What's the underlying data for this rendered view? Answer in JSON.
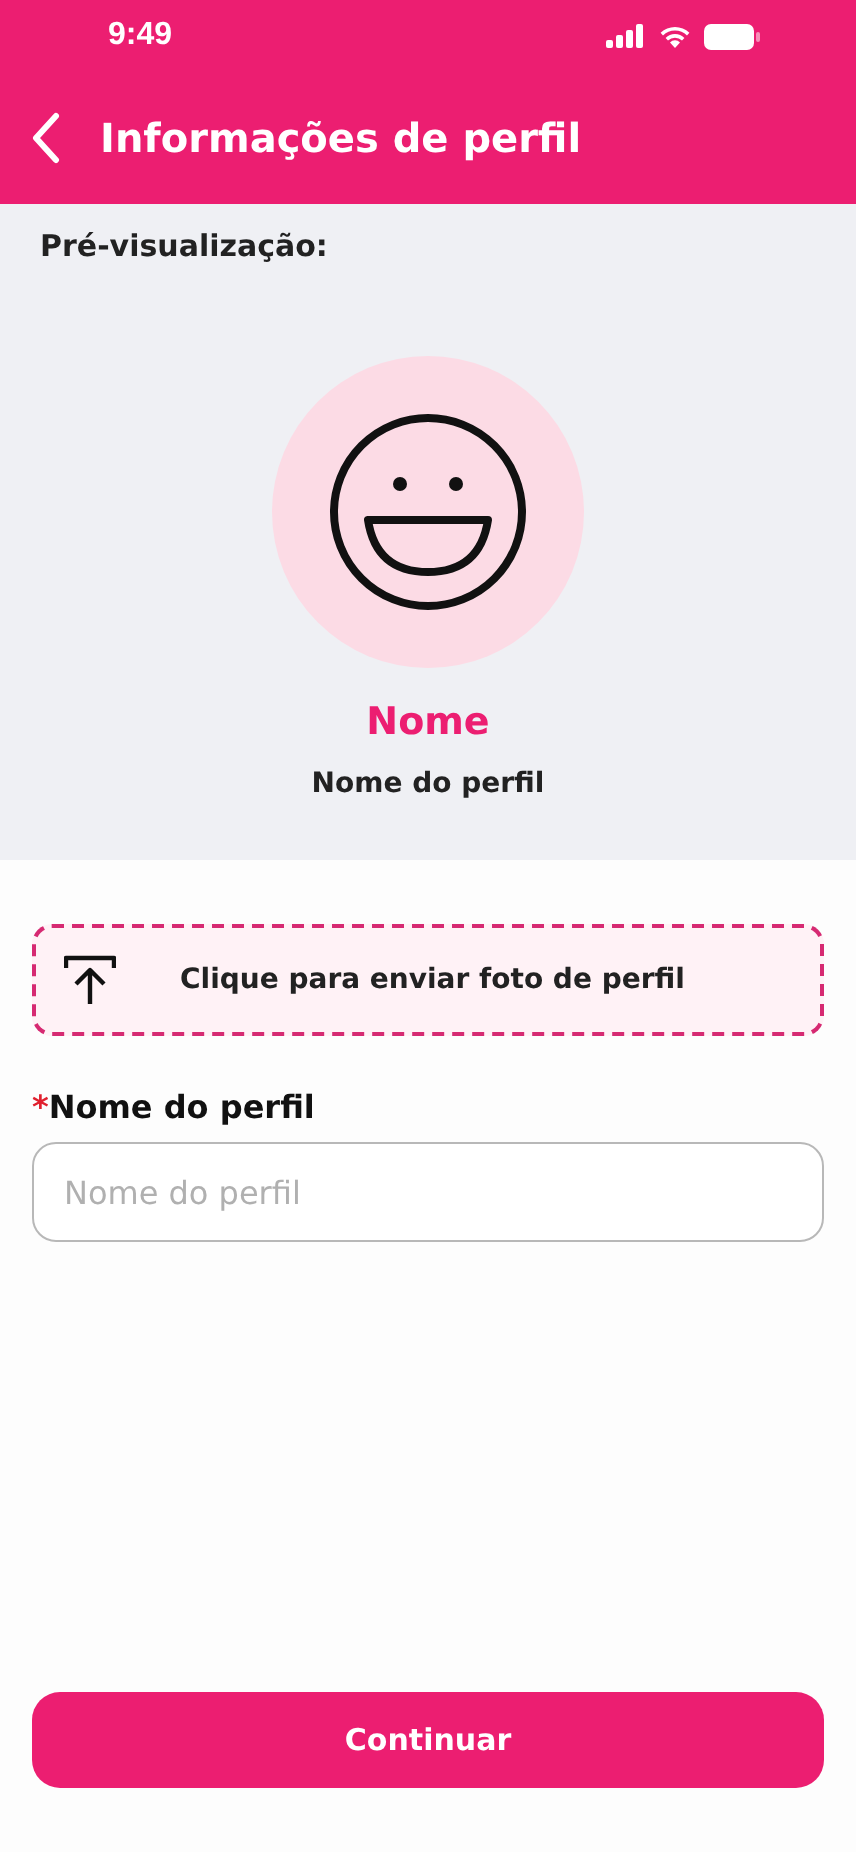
{
  "status_bar": {
    "time": "9:49"
  },
  "header": {
    "title": "Informações de perfil"
  },
  "preview": {
    "label": "Pré-visualização:",
    "name": "Nome",
    "subtitle": "Nome do perfil"
  },
  "upload": {
    "label": "Clique para enviar foto de perfil"
  },
  "field": {
    "required_mark": "*",
    "label": "Nome do perfil",
    "placeholder": "Nome do perfil"
  },
  "buttons": [
    "Continuar"
  ]
}
